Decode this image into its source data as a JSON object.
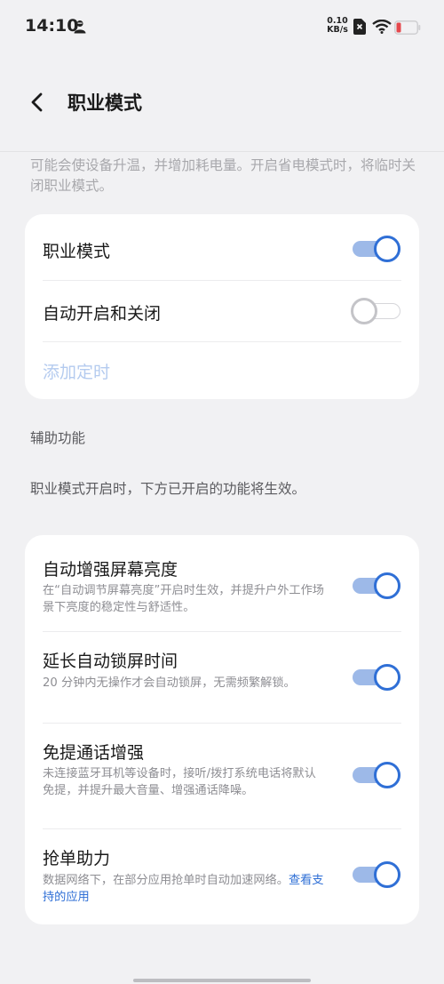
{
  "status_bar": {
    "time": "14:10",
    "net_speed_value": "0.10",
    "net_speed_unit": "KB/s",
    "icons": [
      "person-icon",
      "sim-x-icon",
      "wifi-icon",
      "battery-low-icon"
    ],
    "battery_color": "#e5484d"
  },
  "header": {
    "title": "职业模式",
    "back_icon": "chevron-left-icon"
  },
  "intro_text": "可能会使设备升温，并增加耗电量。开启省电模式时，将临时关闭职业模式。",
  "main_card": {
    "rows": [
      {
        "label": "职业模式",
        "toggle_on": true
      },
      {
        "label": "自动开启和关闭",
        "toggle_on": false
      }
    ],
    "add_timer_label": "添加定时"
  },
  "assist_section": {
    "label": "辅助功能",
    "description": "职业模式开启时，下方已开启的功能将生效。",
    "items": [
      {
        "title": "自动增强屏幕亮度",
        "subtitle": "在“自动调节屏幕亮度”开启时生效，并提升户外工作场景下亮度的稳定性与舒适性。",
        "toggle_on": true
      },
      {
        "title": "延长自动锁屏时间",
        "subtitle": "20 分钟内无操作才会自动锁屏，无需频繁解锁。",
        "toggle_on": true
      },
      {
        "title": "免提通话增强",
        "subtitle": "未连接蓝牙耳机等设备时，接听/拨打系统电话将默认免提，并提升最大音量、增强通话降噪。",
        "toggle_on": true
      },
      {
        "title": "抢单助力",
        "subtitle": "数据网络下，在部分应用抢单时自动加速网络。",
        "link": "查看支持的应用",
        "toggle_on": true
      }
    ]
  },
  "colors": {
    "accent": "#2f6fd6",
    "background": "#f1f1f3",
    "card": "#ffffff"
  }
}
